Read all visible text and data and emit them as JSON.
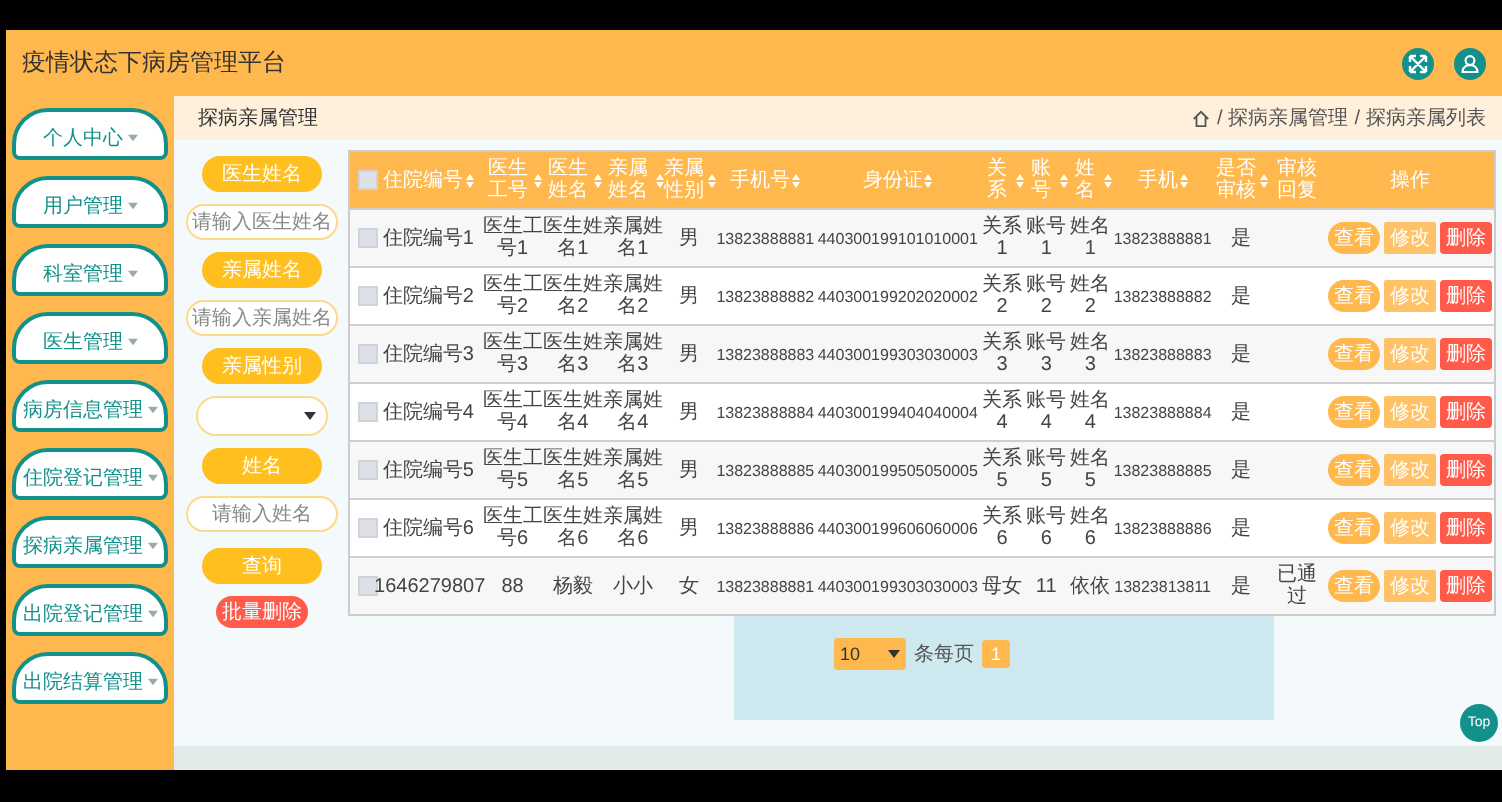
{
  "header": {
    "title": "疫情状态下病房管理平台"
  },
  "sidebar": {
    "items": [
      {
        "label": "个人中心"
      },
      {
        "label": "用户管理"
      },
      {
        "label": "科室管理"
      },
      {
        "label": "医生管理"
      },
      {
        "label": "病房信息管理"
      },
      {
        "label": "住院登记管理"
      },
      {
        "label": "探病亲属管理"
      },
      {
        "label": "出院登记管理"
      },
      {
        "label": "出院结算管理"
      }
    ]
  },
  "page_title": "探病亲属管理",
  "breadcrumb": [
    {
      "separator": "/",
      "text": "探病亲属管理"
    },
    {
      "separator": "/",
      "text": "探病亲属列表"
    }
  ],
  "filters": [
    {
      "kind": "label",
      "text": "医生姓名"
    },
    {
      "kind": "input",
      "placeholder": "请输入医生姓名"
    },
    {
      "kind": "label",
      "text": "亲属姓名"
    },
    {
      "kind": "input",
      "placeholder": "请输入亲属姓名"
    },
    {
      "kind": "label",
      "text": "亲属性别"
    },
    {
      "kind": "select"
    },
    {
      "kind": "label",
      "text": "姓名"
    },
    {
      "kind": "input",
      "placeholder": "请输入姓名"
    }
  ],
  "filter_buttons": [
    {
      "kind": "search",
      "label": "查询"
    },
    {
      "kind": "delete",
      "label": "批量删除"
    }
  ],
  "table": {
    "select_all_checked": false,
    "columns": [
      {
        "label": "住院编号",
        "sortable": true
      },
      {
        "label": "医生工号",
        "sortable": true
      },
      {
        "label": "医生姓名",
        "sortable": true
      },
      {
        "label": "亲属姓名",
        "sortable": true
      },
      {
        "label": "亲属性别",
        "sortable": true
      },
      {
        "label": "手机号",
        "sortable": true
      },
      {
        "label": "身份证",
        "sortable": true
      },
      {
        "label": "关系",
        "sortable": true
      },
      {
        "label": "账号",
        "sortable": true
      },
      {
        "label": "姓名",
        "sortable": true
      },
      {
        "label": "手机",
        "sortable": true
      },
      {
        "label": "是否审核",
        "sortable": true
      },
      {
        "label": "审核回复",
        "sortable": false
      },
      {
        "label": "操作",
        "sortable": false
      }
    ],
    "rows": [
      {
        "checked": false,
        "cells": [
          "住院编号1",
          "医生工号1",
          "医生姓名1",
          "亲属姓名1",
          "男",
          "13823888881",
          "440300199101010001",
          "关系1",
          "账号1",
          "姓名1",
          "13823888881",
          "是"
        ],
        "actions": [
          {
            "kind": "view",
            "label": "查看"
          },
          {
            "kind": "edit",
            "label": "修改"
          },
          {
            "kind": "delete",
            "label": "删除"
          }
        ]
      },
      {
        "checked": false,
        "cells": [
          "住院编号2",
          "医生工号2",
          "医生姓名2",
          "亲属姓名2",
          "男",
          "13823888882",
          "440300199202020002",
          "关系2",
          "账号2",
          "姓名2",
          "13823888882",
          "是"
        ],
        "actions": [
          {
            "kind": "view",
            "label": "查看"
          },
          {
            "kind": "edit",
            "label": "修改"
          },
          {
            "kind": "delete",
            "label": "删除"
          }
        ]
      },
      {
        "checked": false,
        "cells": [
          "住院编号3",
          "医生工号3",
          "医生姓名3",
          "亲属姓名3",
          "男",
          "13823888883",
          "440300199303030003",
          "关系3",
          "账号3",
          "姓名3",
          "13823888883",
          "是"
        ],
        "actions": [
          {
            "kind": "view",
            "label": "查看"
          },
          {
            "kind": "edit",
            "label": "修改"
          },
          {
            "kind": "delete",
            "label": "删除"
          }
        ]
      },
      {
        "checked": false,
        "cells": [
          "住院编号4",
          "医生工号4",
          "医生姓名4",
          "亲属姓名4",
          "男",
          "13823888884",
          "440300199404040004",
          "关系4",
          "账号4",
          "姓名4",
          "13823888884",
          "是"
        ],
        "actions": [
          {
            "kind": "view",
            "label": "查看"
          },
          {
            "kind": "edit",
            "label": "修改"
          },
          {
            "kind": "delete",
            "label": "删除"
          }
        ]
      },
      {
        "checked": false,
        "cells": [
          "住院编号5",
          "医生工号5",
          "医生姓名5",
          "亲属姓名5",
          "男",
          "13823888885",
          "440300199505050005",
          "关系5",
          "账号5",
          "姓名5",
          "13823888885",
          "是"
        ],
        "actions": [
          {
            "kind": "view",
            "label": "查看"
          },
          {
            "kind": "edit",
            "label": "修改"
          },
          {
            "kind": "delete",
            "label": "删除"
          }
        ]
      },
      {
        "checked": false,
        "cells": [
          "住院编号6",
          "医生工号6",
          "医生姓名6",
          "亲属姓名6",
          "男",
          "13823888886",
          "440300199606060006",
          "关系6",
          "账号6",
          "姓名6",
          "13823888886",
          "是"
        ],
        "actions": [
          {
            "kind": "view",
            "label": "查看"
          },
          {
            "kind": "edit",
            "label": "修改"
          },
          {
            "kind": "delete",
            "label": "删除"
          }
        ]
      },
      {
        "checked": false,
        "cells": [
          "1646279807",
          "88",
          "杨毅",
          "小小",
          "女",
          "13823888881",
          "440300199303030003",
          "母女",
          "11",
          "依依",
          "13823813811",
          "是"
        ],
        "reply": "已通过",
        "actions": [
          {
            "kind": "view",
            "label": "查看"
          },
          {
            "kind": "edit",
            "label": "修改"
          },
          {
            "kind": "delete",
            "label": "删除"
          }
        ]
      }
    ]
  },
  "pagination": {
    "page_size": "10",
    "page_size_label": "条每页",
    "pages": [
      {
        "label": "1",
        "selected": true
      }
    ]
  },
  "top_button": "Top"
}
